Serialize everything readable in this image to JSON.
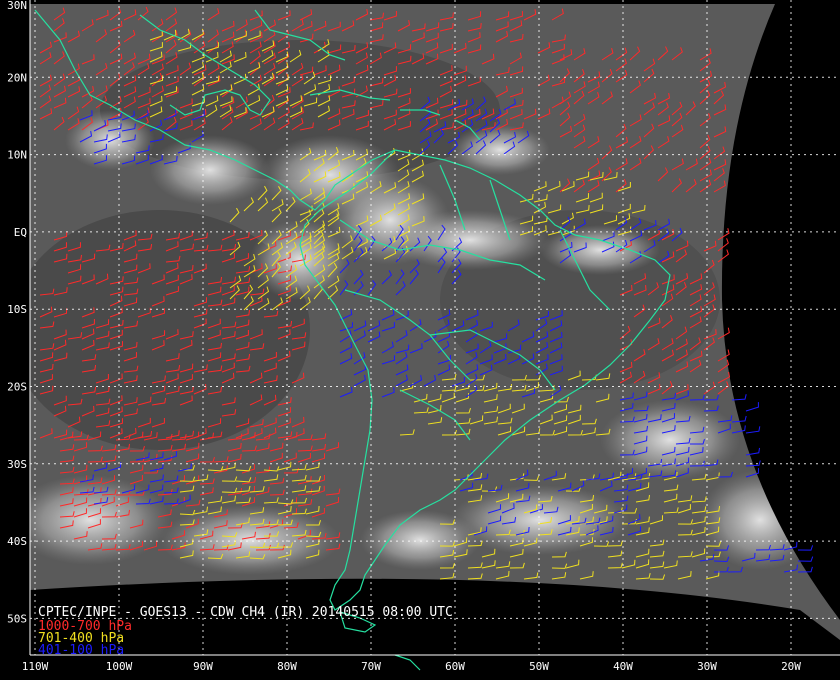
{
  "map": {
    "lat_labels": [
      "30N",
      "20N",
      "10N",
      "EQ",
      "10S",
      "20S",
      "30S",
      "40S",
      "50S"
    ],
    "lon_labels": [
      "110W",
      "100W",
      "90W",
      "80W",
      "70W",
      "60W",
      "50W",
      "40W",
      "30W",
      "20W"
    ],
    "lat_values": [
      30,
      20,
      10,
      0,
      -10,
      -20,
      -30,
      -40,
      -50
    ],
    "lon_values": [
      -110,
      -100,
      -90,
      -80,
      -70,
      -60,
      -50,
      -40,
      -30,
      -20
    ],
    "grid": true,
    "colors": {
      "background": "#000000",
      "coast": "#26e0a0",
      "grid": "#ffffff",
      "low_level": "#ff2a2a",
      "mid_level": "#f0e020",
      "high_level": "#1c1cff"
    }
  },
  "caption": {
    "title": "CPTEC/INPE - GOES13 - CDW CH4 (IR) 20140515 08:00 UTC",
    "legend": [
      {
        "label": "1000-700 hPa",
        "color": "#ff2a2a"
      },
      {
        "label": "701-400 hPa",
        "color": "#f0e020"
      },
      {
        "label": "401-100 hPa",
        "color": "#1c1cff"
      }
    ]
  }
}
